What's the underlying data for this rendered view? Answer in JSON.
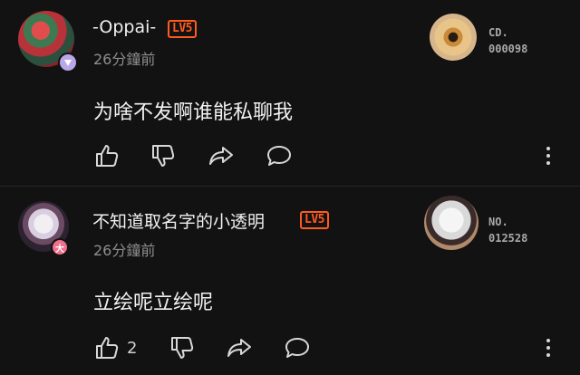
{
  "comments": [
    {
      "username": "-Oppai-",
      "level": "LV5",
      "time": "26分鐘前",
      "text": "为啥不发啊谁能私聊我",
      "fan_label_line1": "CD.",
      "fan_label_line2": "000098",
      "likes": ""
    },
    {
      "username": "不知道取名字的小透明",
      "level": "LV5",
      "time": "26分鐘前",
      "text": "立绘呢立绘呢",
      "badge": "大",
      "fan_label_line1": "NO.",
      "fan_label_line2": "012528",
      "likes": "2"
    }
  ],
  "icons": [
    "thumbs-up-icon",
    "thumbs-down-icon",
    "share-icon",
    "reply-icon",
    "more-icon"
  ],
  "colors": {
    "background": "#121212",
    "level": "#ff5a1f",
    "muted": "#8e8e8e"
  }
}
